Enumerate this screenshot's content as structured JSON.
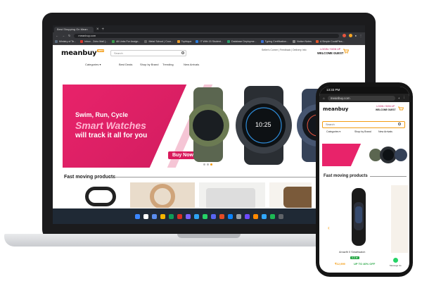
{
  "browser": {
    "tab_title": "Best Shopping On Mean",
    "address": "meanbuy.com",
    "bookmarks": [
      {
        "label": "Ministry of Te...",
        "color": "#5a6b7c"
      },
      {
        "label": "Inbox - Zoho Mail (...",
        "color": "#d9352b"
      },
      {
        "label": "All Links For Assign...",
        "color": "#3a9a4a"
      },
      {
        "label": "Metal School | Coor...",
        "color": "#666"
      },
      {
        "label": "Tophique",
        "color": "#e89b2a"
      },
      {
        "label": "IT With 15 Student...",
        "color": "#2a7ad9"
      },
      {
        "label": "Database Deployme...",
        "color": "#2a9a6a"
      },
      {
        "label": "Typing Certification...",
        "color": "#3b6fd1"
      },
      {
        "label": "Notion Notes",
        "color": "#888"
      },
      {
        "label": "A Simple CookiPlea...",
        "color": "#e0552b"
      }
    ]
  },
  "site": {
    "logo": "meanbuy",
    "logo_badge": "BEST",
    "search_placeholder": "Search",
    "top_links": "Seller's Corner | Feedback | Delivery Info",
    "login_label": "LOGIN / SIGN UP",
    "welcome_label": "WELCOME GUEST",
    "menu": [
      "Categories ▾",
      "Best Deals",
      "Shop by Brand",
      "Trending",
      "New Arrivals"
    ]
  },
  "banner": {
    "line1": "Swim, Run, Cycle",
    "line2": "Smart Watches",
    "line3": "will track it all for you",
    "cta": "Buy Now",
    "watch_time": "10:25",
    "slide_count": 3,
    "active_slide": 3
  },
  "section": {
    "title": "Fast moving products"
  },
  "phone": {
    "status_time": "13:33 PM",
    "address": "meanbuy.com",
    "logo": "meanbuy",
    "login_label": "LOGIN / SIGN UP",
    "welcome_label": "WELCOME GUEST",
    "search_placeholder": "Search",
    "menu": [
      "Categories ▾",
      "Shop by Brand",
      "New Arrivals"
    ],
    "section_title": "Fast moving products",
    "product": {
      "name": "Amazfit X Smartwatch",
      "off_badge": "4.3 ★",
      "price": "₹12,999",
      "discount": "UP TO 40% OFF"
    },
    "whatsapp_label": "Message Us"
  },
  "colors": {
    "brand_orange": "#f39c12",
    "banner_pink": "#e8236a",
    "taskbar": "#1f2935"
  }
}
